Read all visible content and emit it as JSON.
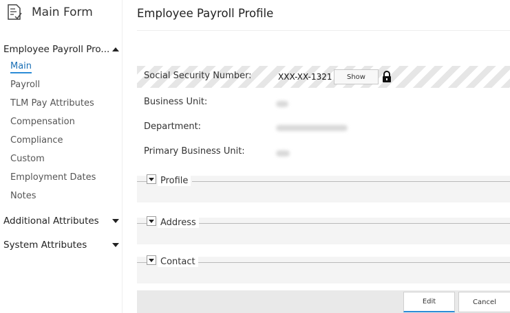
{
  "sidebar": {
    "form_title": "Main Form",
    "form_icon": "form-document-icon",
    "section_payroll": "Employee Payroll Pro...",
    "items": [
      {
        "label": "Main"
      },
      {
        "label": "Payroll"
      },
      {
        "label": "TLM Pay Attributes"
      },
      {
        "label": "Compensation"
      },
      {
        "label": "Compliance"
      },
      {
        "label": "Custom"
      },
      {
        "label": "Employment Dates"
      },
      {
        "label": "Notes"
      }
    ],
    "section_additional": "Additional Attributes",
    "section_system": "System Attributes"
  },
  "main": {
    "title": "Employee Payroll Profile",
    "fields": {
      "ssn_label": "Social Security Number:",
      "ssn_value": "XXX-XX-1321",
      "show_label": "Show",
      "business_unit_label": "Business Unit:",
      "department_label": "Department:",
      "primary_business_unit_label": "Primary Business Unit:"
    },
    "groups": {
      "profile": "Profile",
      "address": "Address",
      "contact": "Contact"
    }
  },
  "footer": {
    "edit_label": "Edit",
    "cancel_label": "Cancel"
  },
  "colors": {
    "accent": "#2a8bd6",
    "active_link": "#1a6fb5"
  }
}
